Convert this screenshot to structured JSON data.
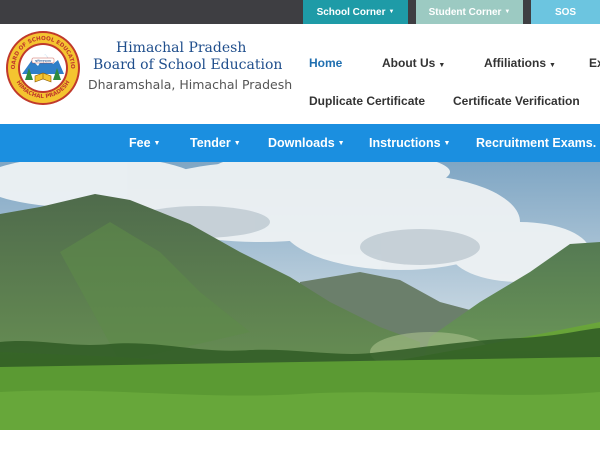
{
  "topbar": {
    "school_corner": "School Corner",
    "student_corner": "Student Corner",
    "sos": "SOS"
  },
  "header": {
    "org_name_line1": "Himachal Pradesh",
    "org_name_line2": "Board of School Education",
    "location": "Dharamshala, Himachal Pradesh",
    "logo": {
      "ring_text_top": "BOARD OF SCHOOL EDUCATION",
      "ring_text_bottom": "HIMACHAL PRADESH",
      "ribbon_text": "ऋषिणःहऋमाम"
    }
  },
  "nav_primary": {
    "home": "Home",
    "about": "About Us",
    "affiliations": "Affiliations",
    "ex": "Ex",
    "duplicate_certificate": "Duplicate Certificate",
    "certificate_verification": "Certificate Verification"
  },
  "nav_secondary": {
    "fee": "Fee",
    "tender": "Tender",
    "downloads": "Downloads",
    "instructions": "Instructions",
    "recruitment": "Recruitment Exams."
  },
  "icons": {
    "caret": "caret-down-icon"
  },
  "colors": {
    "topbar_bg": "#3e3e42",
    "school_corner_bg": "#1e9ba7",
    "student_corner_bg": "#9ccac2",
    "sos_bg": "#6cc5e0",
    "nav_bar_bg": "#1b8fe0",
    "brand_text": "#1f4e8c",
    "active_link": "#1f6fb0"
  }
}
